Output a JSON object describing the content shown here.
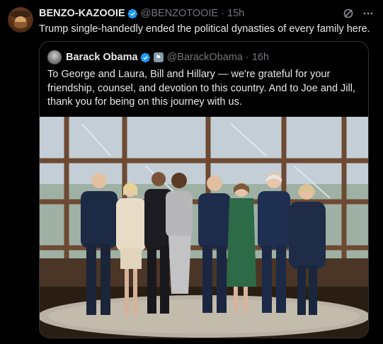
{
  "tweet": {
    "author_name": "BENZO-KAZOOIE",
    "author_handle": "@BENZOTOOIE",
    "separator": "·",
    "time": "15h",
    "text": "Trump single-handedly ended the political dynasties of every family here.",
    "icons": {
      "verified": "verified-badge-icon",
      "grok": "grok-icon",
      "more": "more-icon"
    }
  },
  "quote": {
    "author_name": "Barack Obama",
    "author_handle": "@BarackObama",
    "separator": "·",
    "time": "16h",
    "text": "To George and Laura, Bill and Hillary — we're grateful for your friendship, counsel, and devotion to this country. And to Joe and Jill, thank you for being on this journey with us.",
    "icons": {
      "verified": "verified-badge-icon",
      "affiliation": "government-badge-icon"
    }
  },
  "colors": {
    "accent": "#1d9bf0",
    "text": "#e7e9ea",
    "muted": "#71767b",
    "border": "#2f3336",
    "background": "#000000"
  }
}
